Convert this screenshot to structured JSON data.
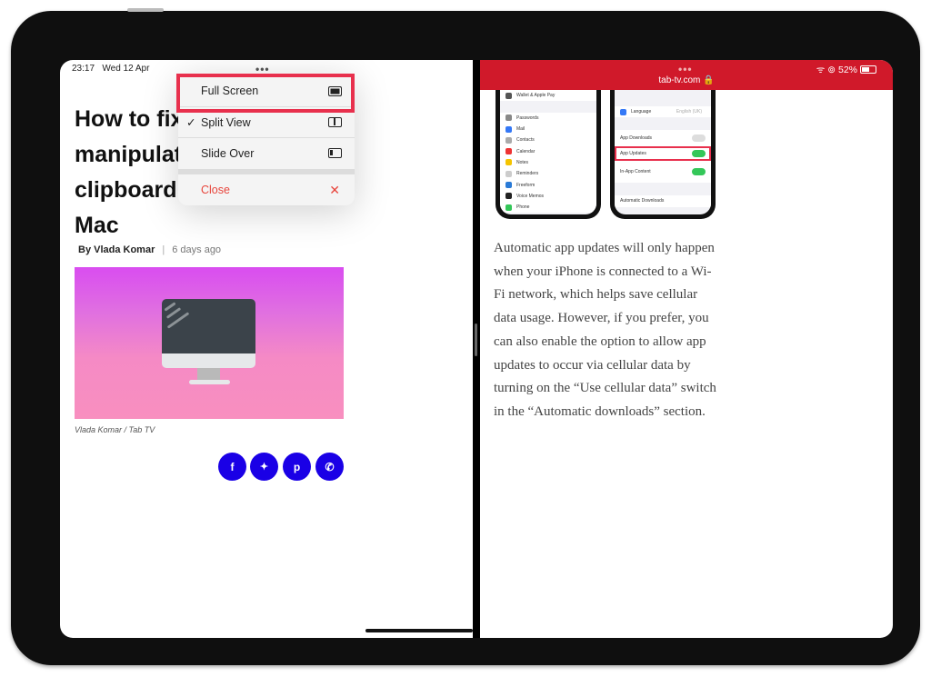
{
  "left": {
    "status": {
      "time": "23:17",
      "date": "Wed 12 Apr"
    },
    "multitask_dots": "•••",
    "article": {
      "title_lines": [
        "How to fix",
        "manipulat",
        "clipboard",
        "Mac"
      ],
      "author": "By Vlada Komar",
      "separator": "|",
      "date": "6 days ago",
      "image_caption": "Vlada Komar / Tab TV",
      "share": [
        {
          "icon": "facebook-icon",
          "glyph": "f"
        },
        {
          "icon": "twitter-icon",
          "glyph": "🐦"
        },
        {
          "icon": "pinterest-icon",
          "glyph": "p"
        },
        {
          "icon": "whatsapp-icon",
          "glyph": "✆"
        }
      ]
    },
    "menu": {
      "items": [
        {
          "label": "Full Screen",
          "icon": "full-screen-icon",
          "checked": false,
          "highlighted": true
        },
        {
          "label": "Split View",
          "icon": "split-view-icon",
          "checked": true
        },
        {
          "label": "Slide Over",
          "icon": "slide-over-icon",
          "checked": false
        },
        {
          "label": "Close",
          "icon": "close-icon",
          "destructive": true
        }
      ],
      "check_glyph": "✓",
      "close_glyph": "✕"
    }
  },
  "right": {
    "multitask_dots": "•••",
    "url": "tab-tv.com 🔒",
    "battery": "52%",
    "status_icons": "ᯤ ⊚",
    "phone1_rows": [
      "Wallet & Apple Pay",
      "",
      "Passwords",
      "Mail",
      "Contacts",
      "Calendar",
      "Notes",
      "Reminders",
      "Freeform",
      "Voice Memos",
      "Phone"
    ],
    "phone2_rows": [
      "Language",
      "App Downloads",
      "App Updates",
      "In-App Content",
      "Automatic Downloads"
    ],
    "phone2_language_value": "English (UK)",
    "paragraph": "Automatic app updates will only happen when your iPhone is connected to a Wi-Fi network, which helps save cellular data usage. However, if you prefer, you can also enable the option to allow app updates to occur via cellular data by turning on the “Use cellular data” switch in the “Automatic downloads” section."
  },
  "colors": {
    "accent_red": "#d0192a",
    "highlight": "#e8304d",
    "share_blue": "#1a00e6",
    "destructive": "#e8453c"
  }
}
